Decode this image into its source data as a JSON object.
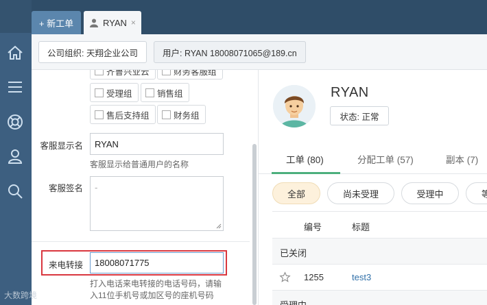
{
  "tabs": {
    "new_label": "+ 新工单",
    "user_tab_label": "RYAN",
    "close_glyph": "×"
  },
  "subbar": {
    "org_label": "公司组织: 天翔企业公司",
    "user_label": "用户: RYAN 18008071065@189.cn"
  },
  "groups": [
    {
      "label": "齐鲁兴业云"
    },
    {
      "label": "财务客服组"
    },
    {
      "label": "受理组"
    },
    {
      "label": "销售组"
    },
    {
      "label": "售后支持组"
    },
    {
      "label": "财务组"
    }
  ],
  "form": {
    "display_name_label": "客服显示名",
    "display_name_value": "RYAN",
    "display_name_hint": "客服显示给普通用户的名称",
    "signature_label": "客服签名",
    "signature_value": "-",
    "forward_label": "来电转接",
    "forward_value": "18008071775",
    "forward_hint_1": "打入电话来电转接的电话号码，请输",
    "forward_hint_2": "入11位手机号或加区号的座机号码"
  },
  "profile": {
    "name": "RYAN",
    "status": "状态: 正常"
  },
  "right_tabs": [
    {
      "label": "工单 (80)",
      "active": true
    },
    {
      "label": "分配工单 (57)",
      "active": false
    },
    {
      "label": "副本 (7)",
      "active": false
    }
  ],
  "filters": [
    {
      "label": "全部",
      "active": true
    },
    {
      "label": "尚未受理",
      "active": false
    },
    {
      "label": "受理中",
      "active": false
    },
    {
      "label": "等",
      "active": false
    }
  ],
  "table": {
    "col_number": "编号",
    "col_title": "标题",
    "groups": [
      {
        "label": "已关闭"
      },
      {
        "label": "受理中"
      }
    ],
    "rows": [
      {
        "number": "1255",
        "title": "test3"
      }
    ]
  },
  "watermark": "大数跨境",
  "colors": {
    "sidebar": "#3d5f80",
    "accent_green": "#4caf7d",
    "highlight_red": "#d9363e",
    "link_blue": "#2f6fa8"
  }
}
